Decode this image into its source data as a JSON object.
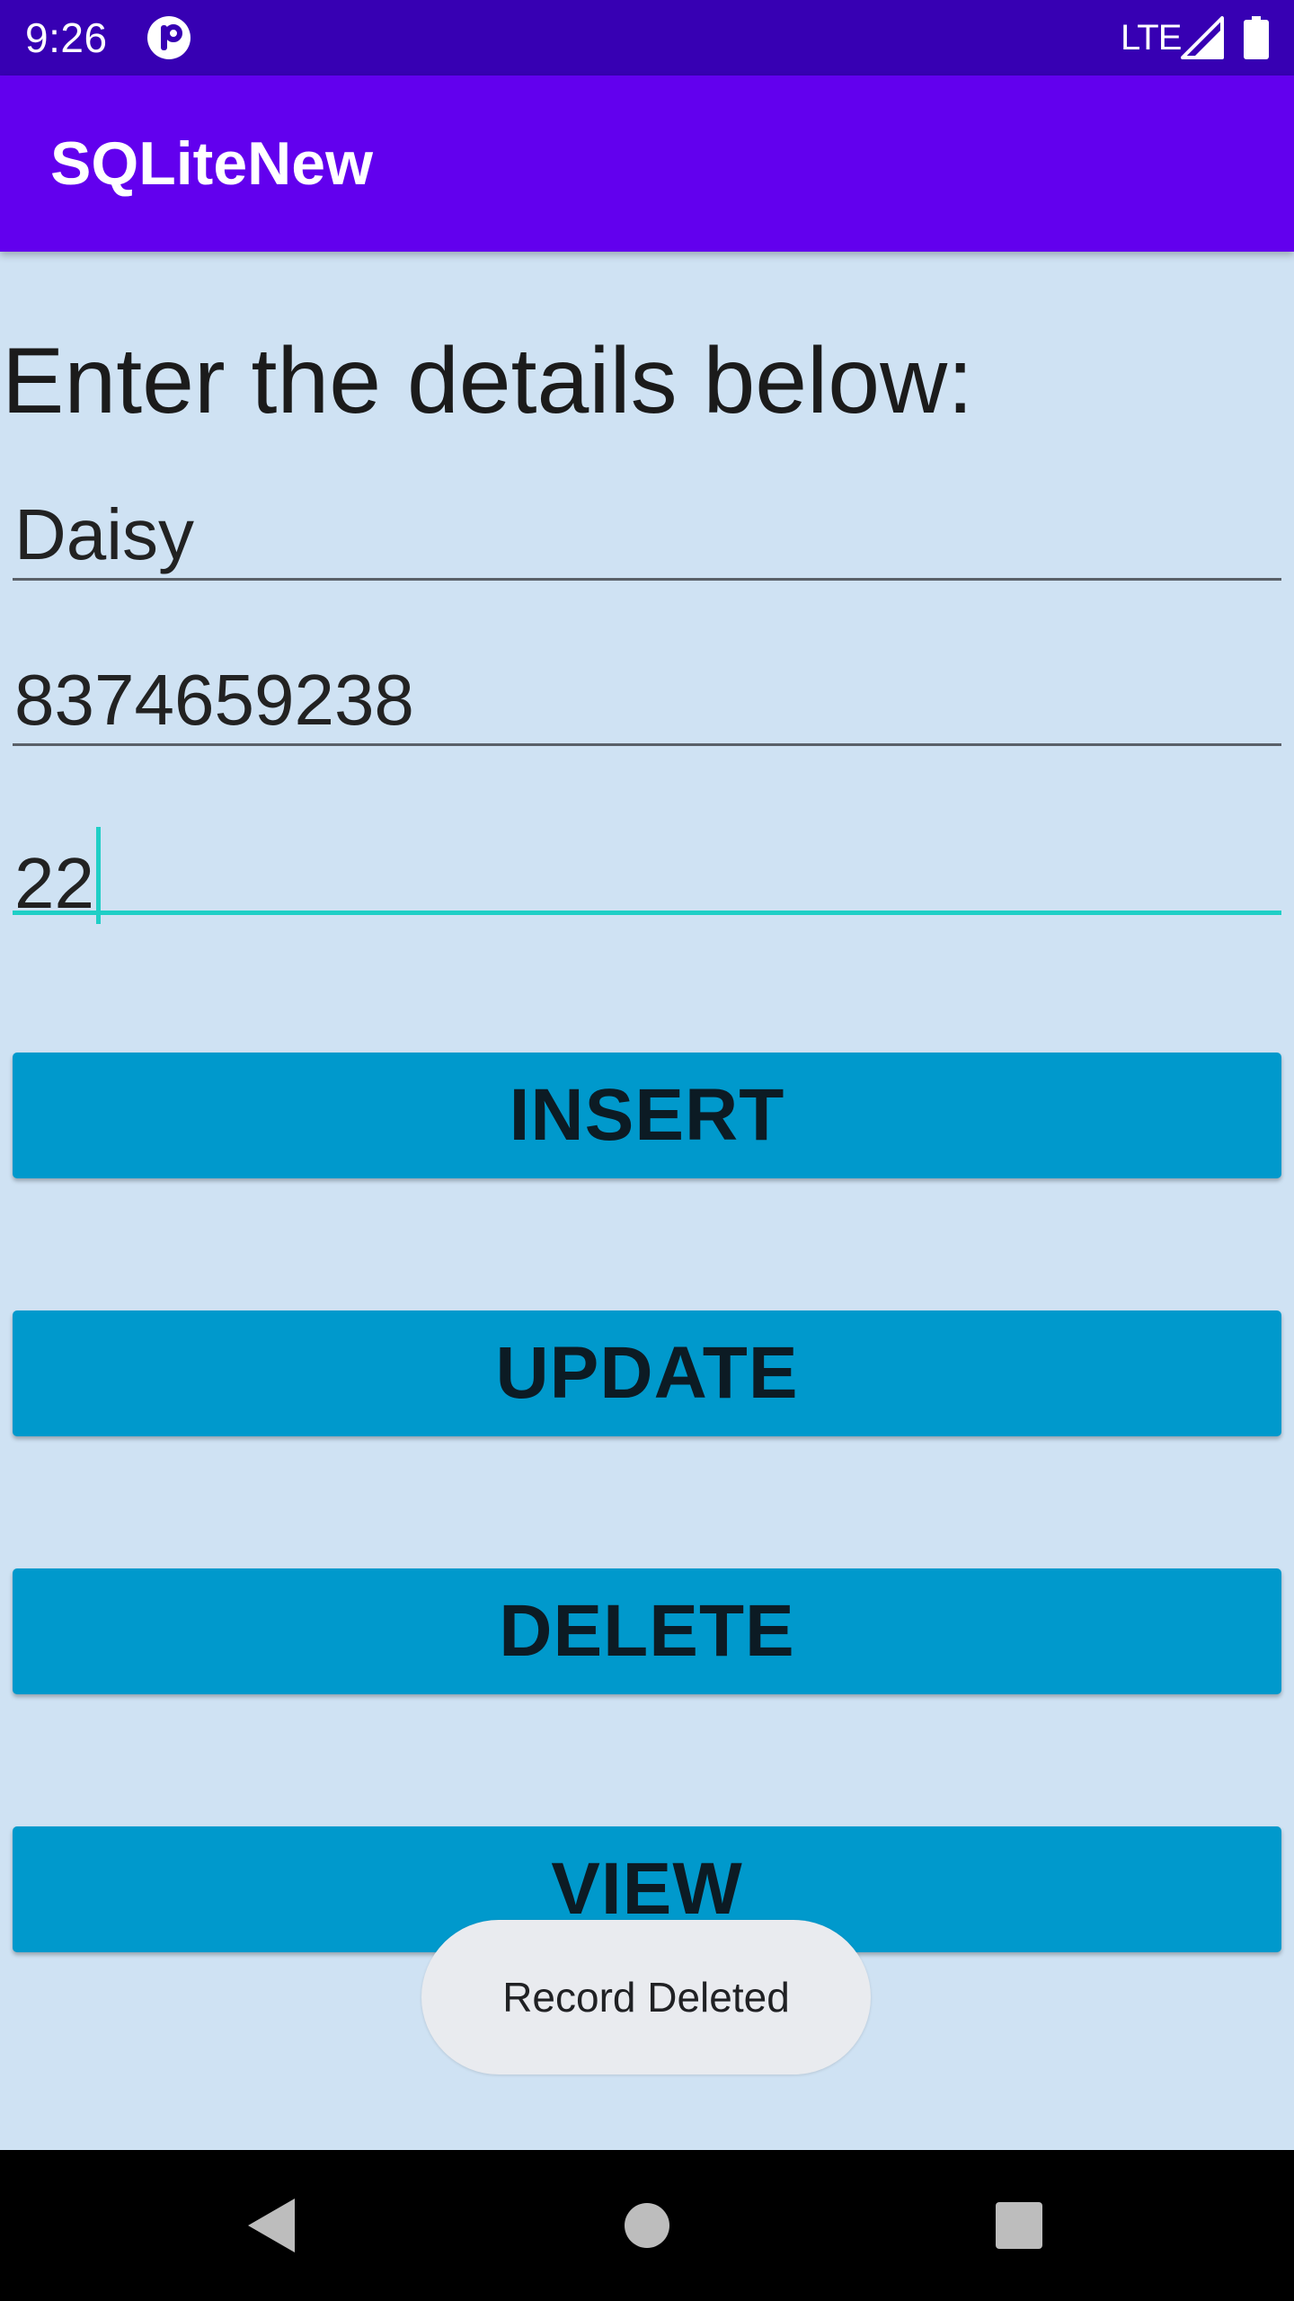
{
  "status_bar": {
    "time": "9:26",
    "network": "LTE",
    "icons": [
      "app-notification-icon",
      "signal-icon",
      "battery-icon"
    ]
  },
  "app_bar": {
    "title": "SQLiteNew"
  },
  "form": {
    "heading": "Enter the details below:",
    "fields": [
      {
        "value": "Daisy",
        "focused": false
      },
      {
        "value": "8374659238",
        "focused": false
      },
      {
        "value": "22",
        "focused": true
      }
    ]
  },
  "buttons": {
    "insert": "INSERT",
    "update": "UPDATE",
    "delete": "DELETE",
    "view": "VIEW"
  },
  "toast": {
    "message": "Record Deleted"
  },
  "nav_bar": {
    "icons": [
      "back-icon",
      "home-icon",
      "recents-icon"
    ]
  },
  "colors": {
    "status_bar": "#3700b3",
    "app_bar": "#6200ee",
    "background": "#cfe2f3",
    "button": "#0099cc",
    "accent": "#1fcfc6"
  }
}
